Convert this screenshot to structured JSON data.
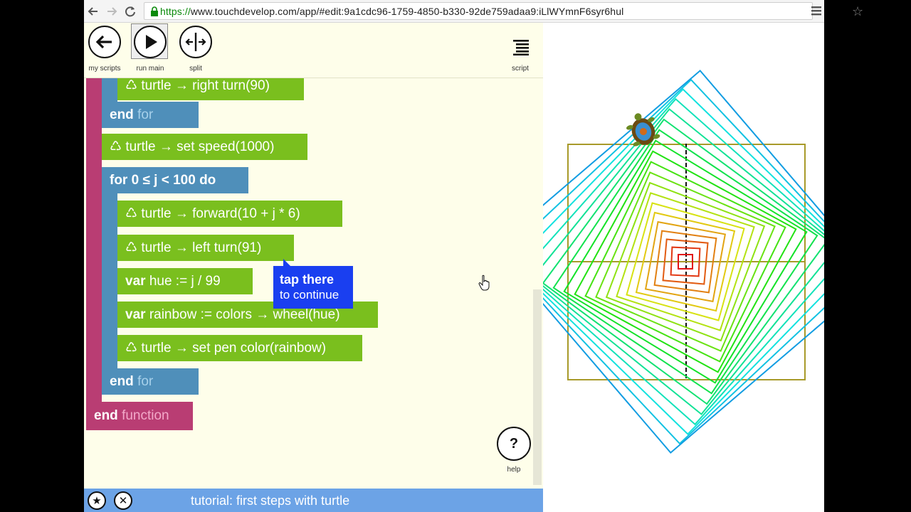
{
  "browser": {
    "url_protocol": "https://",
    "url_rest": "www.touchdevelop.com/app/#edit:9a1cdc96-1759-4850-b330-92de759adaa9:iLlWYmnF6syr6hul",
    "icons": [
      "back-icon",
      "forward-icon",
      "reload-icon",
      "lock-icon",
      "star-icon",
      "menu-icon"
    ]
  },
  "toolbar": {
    "my_scripts": "my scripts",
    "run_main": "run main",
    "split": "split",
    "script": "script"
  },
  "code": {
    "line_right_turn": "turtle → right turn(90)",
    "end1": "end",
    "for1": "for",
    "line_set_speed": "turtle → set speed(1000)",
    "for_kw": "for",
    "for_range": "0 ≤ j < 100",
    "do_kw": "do",
    "line_forward": "turtle → forward(10 + j * 6)",
    "line_left_turn": "turtle → left turn(91)",
    "var1_kw": "var",
    "var1_rest": "hue := j / 99",
    "var2_kw": "var",
    "var2_rest": "rainbow := colors → wheel(hue)",
    "line_pen_color": "turtle → set pen color(rainbow)",
    "end2": "end",
    "for2": "for",
    "end3": "end",
    "function_kw": "function",
    "lib_glyph": "♺"
  },
  "tooltip": {
    "line1": "tap there",
    "line2": "to continue"
  },
  "help": {
    "glyph": "?",
    "label": "help"
  },
  "tutorial": {
    "star_glyph": "★",
    "close_glyph": "✕",
    "title": "tutorial: first steps with turtle"
  },
  "colors": {
    "green_block": "#7abf1e",
    "blue_block": "#4f8fba",
    "pink_block": "#b93d73",
    "editor_bg": "#fefeea",
    "tooltip_bg": "#1a3ff0",
    "tutorial_bar": "#6ca3e6"
  }
}
